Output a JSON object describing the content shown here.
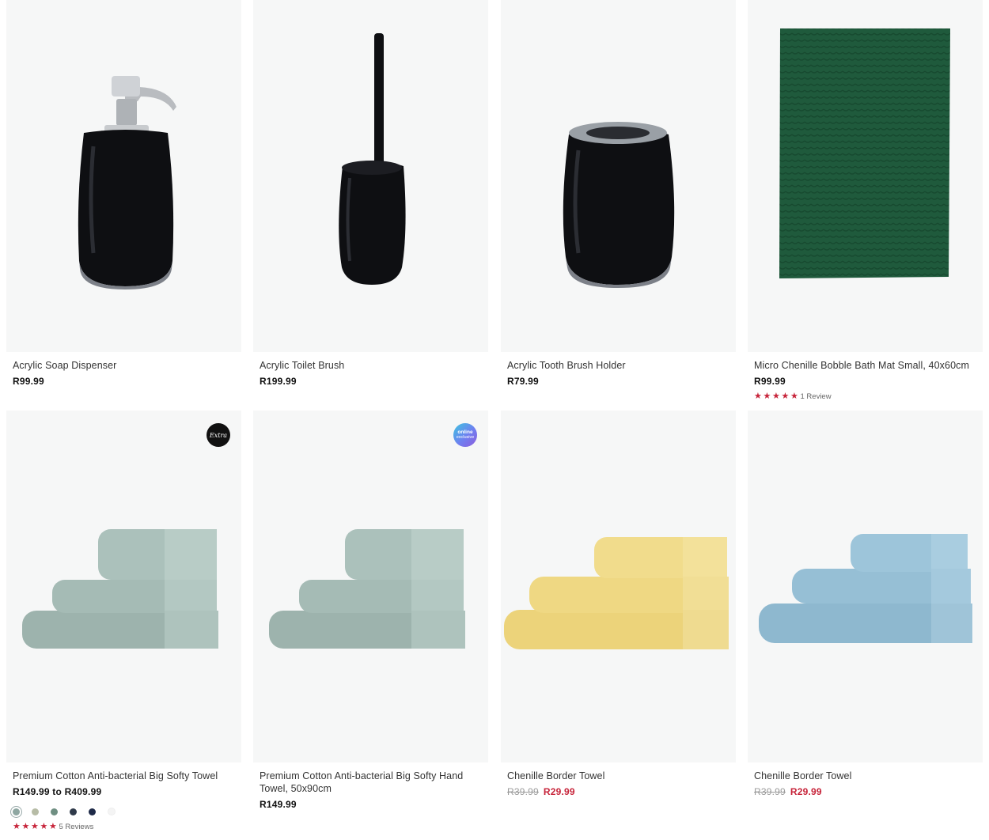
{
  "colors": {
    "image_bg": "#f6f7f7",
    "sale_red": "#c7243a",
    "star_red": "#c7243a"
  },
  "products": [
    {
      "name": "Acrylic Soap Dispenser",
      "price": "R99.99",
      "image_icon": "soap-dispenser-image"
    },
    {
      "name": "Acrylic Toilet Brush",
      "price": "R199.99",
      "image_icon": "toilet-brush-image"
    },
    {
      "name": "Acrylic Tooth Brush Holder",
      "price": "R79.99",
      "image_icon": "toothbrush-holder-image"
    },
    {
      "name": "Micro Chenille Bobble Bath Mat Small, 40x60cm",
      "price": "R99.99",
      "rating": 5,
      "reviews": "1 Review",
      "image_icon": "bath-mat-image"
    },
    {
      "name": "Premium Cotton Anti-bacterial Big Softy Towel",
      "price": "R149.99 to R409.99",
      "badge": "Extra",
      "swatches": [
        "#8fa7a2",
        "#b7bca6",
        "#6f8f82",
        "#2f3a4a",
        "#1e2a48",
        "#f4f4f4"
      ],
      "rating": 5,
      "reviews": "5 Reviews",
      "image_icon": "towel-stack-image"
    },
    {
      "name": "Premium Cotton Anti-bacterial Big Softy Hand Towel, 50x90cm",
      "price": "R149.99",
      "badge_line1": "online",
      "badge_line2": "exclusive",
      "image_icon": "towel-stack-image"
    },
    {
      "name": "Chenille Border Towel",
      "was_price": "R39.99",
      "price": "R29.99",
      "image_icon": "towel-stack-image"
    },
    {
      "name": "Chenille Border Towel",
      "was_price": "R39.99",
      "price": "R29.99",
      "image_icon": "towel-stack-image"
    }
  ]
}
